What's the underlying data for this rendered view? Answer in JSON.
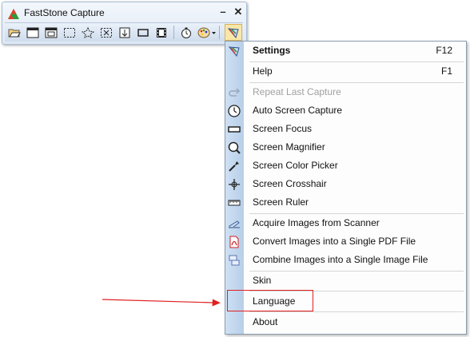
{
  "toolbar": {
    "title": "FastStone Capture",
    "minimize_glyph": "–",
    "close_glyph": "✕",
    "buttons": [
      {
        "icon": "open-folder-icon"
      },
      {
        "icon": "capture-window-icon"
      },
      {
        "icon": "capture-object-icon"
      },
      {
        "icon": "capture-rectangle-icon"
      },
      {
        "icon": "capture-freehand-icon"
      },
      {
        "icon": "capture-fullscreen-icon"
      },
      {
        "icon": "capture-scrolling-icon"
      },
      {
        "icon": "capture-fixed-region-icon"
      },
      {
        "icon": "record-video-icon"
      },
      {
        "icon": "delay-timer-icon"
      },
      {
        "icon": "output-palette-icon"
      },
      {
        "icon": "settings-menu-icon"
      }
    ]
  },
  "menu": {
    "items": [
      {
        "label": "Settings",
        "shortcut": "F12",
        "icon": "settings-icon",
        "bold": true
      },
      {
        "label": "Help",
        "shortcut": "F1",
        "icon": ""
      },
      {
        "label": "Repeat Last Capture",
        "shortcut": "",
        "icon": "repeat-icon",
        "disabled": true
      },
      {
        "label": "Auto Screen Capture",
        "shortcut": "",
        "icon": "clock-icon"
      },
      {
        "label": "Screen Focus",
        "shortcut": "",
        "icon": "focus-bar-icon"
      },
      {
        "label": "Screen Magnifier",
        "shortcut": "",
        "icon": "magnifier-icon"
      },
      {
        "label": "Screen Color Picker",
        "shortcut": "",
        "icon": "eyedropper-icon"
      },
      {
        "label": "Screen Crosshair",
        "shortcut": "",
        "icon": "crosshair-icon"
      },
      {
        "label": "Screen Ruler",
        "shortcut": "",
        "icon": "ruler-icon"
      },
      {
        "label": "Acquire Images from Scanner",
        "shortcut": "",
        "icon": "scanner-icon"
      },
      {
        "label": "Convert Images into a Single PDF File",
        "shortcut": "",
        "icon": "pdf-icon"
      },
      {
        "label": "Combine Images into a Single Image File",
        "shortcut": "",
        "icon": "combine-images-icon"
      },
      {
        "label": "Skin",
        "shortcut": "",
        "icon": ""
      },
      {
        "label": "Language",
        "shortcut": "",
        "icon": ""
      },
      {
        "label": "About",
        "shortcut": "",
        "icon": ""
      }
    ]
  },
  "annotation": {
    "color": "#e02020"
  }
}
